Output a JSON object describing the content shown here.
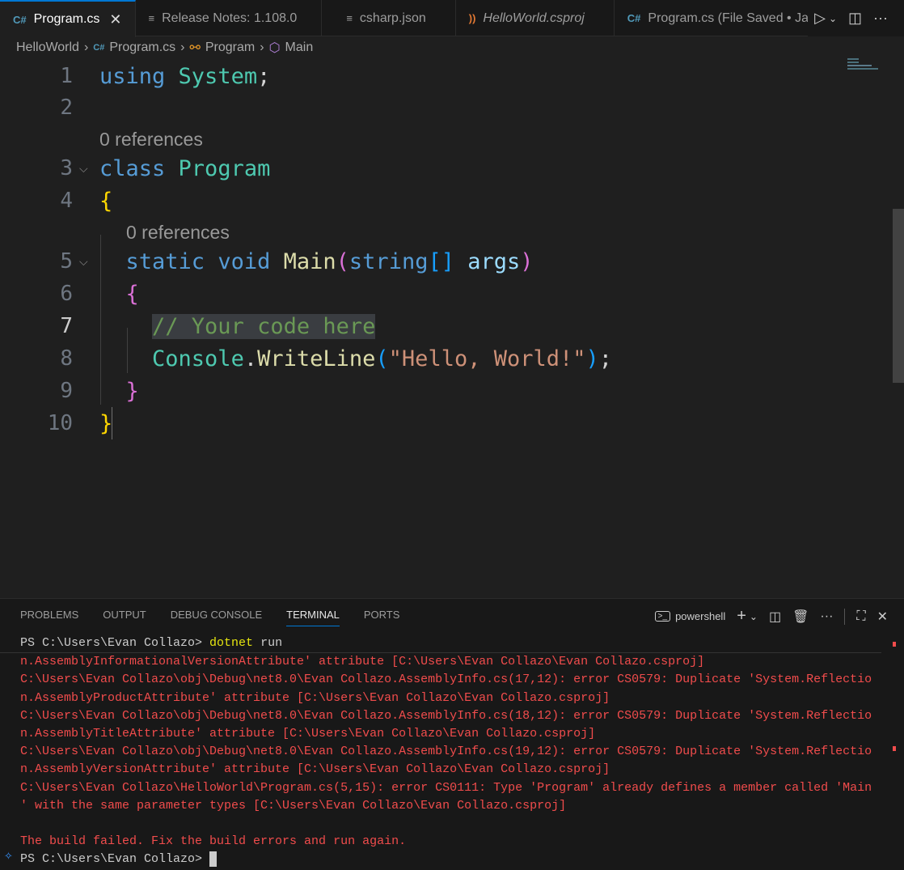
{
  "tabs": [
    {
      "label": "Program.cs",
      "icon": "csharp-icon",
      "active": true
    },
    {
      "label": "Release Notes: 1.108.0",
      "icon": "document-icon"
    },
    {
      "label": "csharp.json",
      "icon": "document-icon"
    },
    {
      "label": "HelloWorld.csproj",
      "icon": "rss-icon"
    },
    {
      "label": "Program.cs (File Saved • Jan",
      "icon": "csharp-icon"
    }
  ],
  "breadcrumb": [
    "HelloWorld",
    "Program.cs",
    "Program",
    "Main"
  ],
  "editor": {
    "line_numbers": [
      "1",
      "2",
      "3",
      "4",
      "5",
      "6",
      "7",
      "8",
      "9",
      "10"
    ],
    "codelens": "0 references",
    "code": {
      "l1a": "using",
      "l1b": "System",
      "l1c": ";",
      "l3a": "class",
      "l3b": "Program",
      "l4": "{",
      "l5a": "static",
      "l5b": "void",
      "l5c": "Main",
      "l5d": "(",
      "l5e": "string",
      "l5f": "[]",
      "l5g": "args",
      "l5h": ")",
      "l6": "{",
      "l7": "// Your code here",
      "l8a": "Console",
      "l8b": ".",
      "l8c": "WriteLine",
      "l8d": "(",
      "l8e": "\"Hello, World!\"",
      "l8f": ")",
      "l8g": ";",
      "l9": "}",
      "l10": "}"
    }
  },
  "panel": {
    "tabs": [
      "PROBLEMS",
      "OUTPUT",
      "DEBUG CONSOLE",
      "TERMINAL",
      "PORTS"
    ],
    "active_tab": "TERMINAL",
    "shell": "powershell",
    "terminal": {
      "prompt": "PS C:\\Users\\Evan Collazo> ",
      "command": "dotnet",
      "command_args": " run",
      "errors": [
        "n.AssemblyInformationalVersionAttribute' attribute [C:\\Users\\Evan Collazo\\Evan Collazo.csproj]",
        "C:\\Users\\Evan Collazo\\obj\\Debug\\net8.0\\Evan Collazo.AssemblyInfo.cs(17,12): error CS0579: Duplicate 'System.Reflectio",
        "n.AssemblyProductAttribute' attribute [C:\\Users\\Evan Collazo\\Evan Collazo.csproj]",
        "C:\\Users\\Evan Collazo\\obj\\Debug\\net8.0\\Evan Collazo.AssemblyInfo.cs(18,12): error CS0579: Duplicate 'System.Reflectio",
        "n.AssemblyTitleAttribute' attribute [C:\\Users\\Evan Collazo\\Evan Collazo.csproj]",
        "C:\\Users\\Evan Collazo\\obj\\Debug\\net8.0\\Evan Collazo.AssemblyInfo.cs(19,12): error CS0579: Duplicate 'System.Reflectio",
        "n.AssemblyVersionAttribute' attribute [C:\\Users\\Evan Collazo\\Evan Collazo.csproj]",
        "C:\\Users\\Evan Collazo\\HelloWorld\\Program.cs(5,15): error CS0111: Type 'Program' already defines a member called 'Main",
        "' with the same parameter types [C:\\Users\\Evan Collazo\\Evan Collazo.csproj]"
      ],
      "failure": "The build failed. Fix the build errors and run again.",
      "final_prompt": "PS C:\\Users\\Evan Collazo> "
    }
  }
}
